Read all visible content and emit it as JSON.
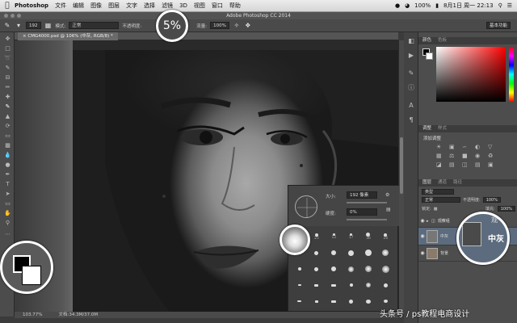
{
  "menubar": {
    "app": "Photoshop",
    "items": [
      "文件",
      "编辑",
      "图像",
      "图层",
      "文字",
      "选择",
      "滤镜",
      "3D",
      "视图",
      "窗口",
      "帮助"
    ],
    "battery": "100%",
    "datetime": "8月1日 周一 22:13"
  },
  "window": {
    "title": "Adobe Photoshop CC 2014"
  },
  "options": {
    "brush_size": "192",
    "mode_label": "模式:",
    "mode_value": "正常",
    "opacity_label": "不透明度:",
    "flow_label": "流量:",
    "flow_value": "100%",
    "workspace": "基本功能"
  },
  "document": {
    "tab": "CMG4000.psd @ 106% (中灰, RGB/8) *",
    "zoom": "103.77%",
    "doc_size": "文档:34.3M/37.0M"
  },
  "panels": {
    "color_tabs": [
      "颜色",
      "色板"
    ],
    "adjust_tabs": [
      "调整",
      "样式"
    ],
    "adjust_title": "添加调整",
    "layer_tabs": [
      "图层",
      "通道",
      "路径"
    ],
    "layer_kind": "类型",
    "blend_mode": "正常",
    "opacity_label": "不透明度:",
    "opacity_value": "100%",
    "lock_label": "锁定:",
    "fill_label": "填充:",
    "fill_value": "100%",
    "layers": [
      {
        "name": "观察组"
      },
      {
        "name": "中灰"
      },
      {
        "name": "背景"
      }
    ]
  },
  "brush_popup": {
    "size_label": "大小:",
    "size_value": "192 像素",
    "hardness_label": "硬度:",
    "hardness_value": "0%",
    "preset_sizes": [
      "45",
      "25",
      "12",
      "17",
      "36",
      "26"
    ]
  },
  "callouts": {
    "size": "5%",
    "layer_label": "中灰",
    "layer_top": "观"
  },
  "watermark": "头条号 / ps教程电商设计",
  "colors": {
    "ui_dark": "#3b3b3b",
    "panel": "#4d4d4d",
    "callout_layer": "#5c6c7e"
  }
}
